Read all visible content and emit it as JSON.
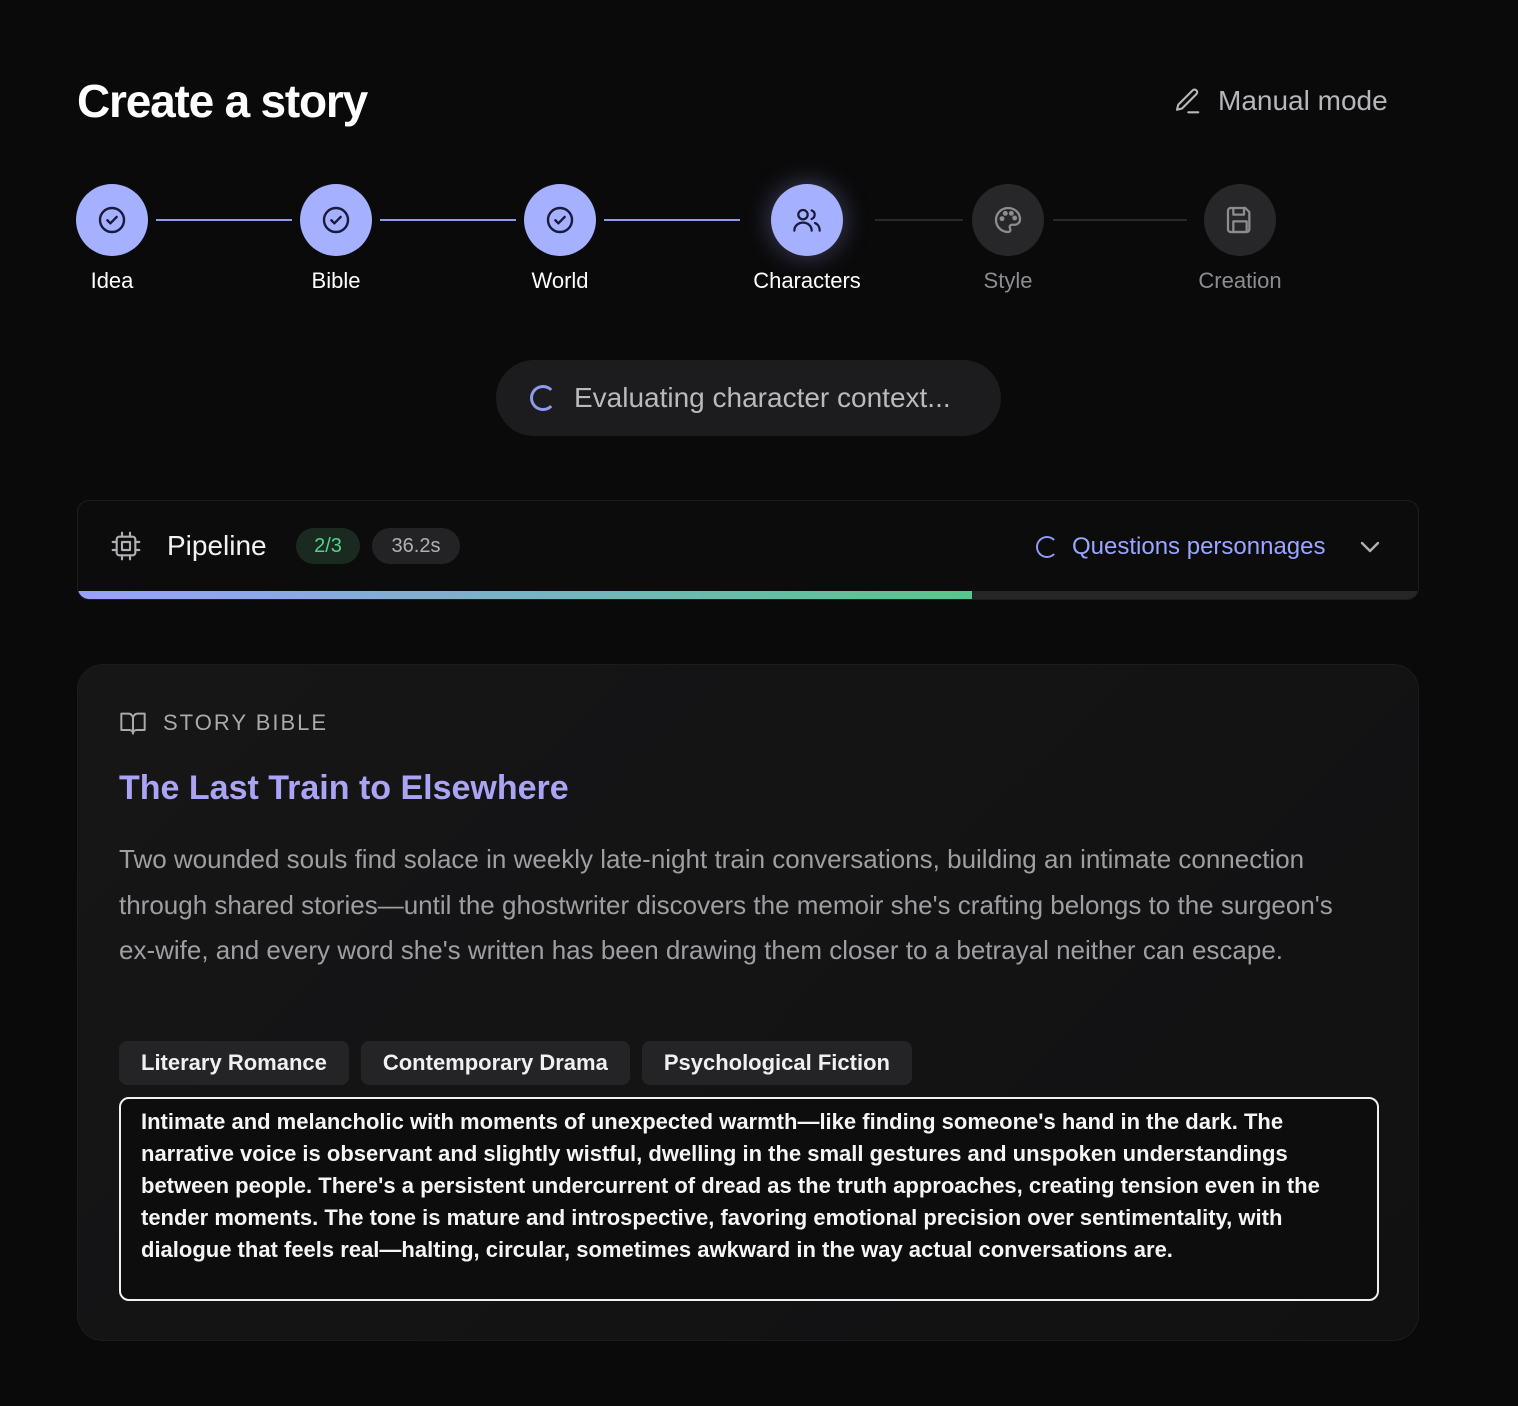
{
  "header": {
    "title": "Create a story",
    "manual_mode_label": "Manual mode",
    "manual_mode_icon": "pencil-icon"
  },
  "stepper": {
    "steps": [
      {
        "label": "Idea",
        "state": "done",
        "icon": "check-circle-icon"
      },
      {
        "label": "Bible",
        "state": "done",
        "icon": "check-circle-icon"
      },
      {
        "label": "World",
        "state": "done",
        "icon": "check-circle-icon"
      },
      {
        "label": "Characters",
        "state": "active",
        "icon": "users-icon"
      },
      {
        "label": "Style",
        "state": "todo",
        "icon": "palette-icon"
      },
      {
        "label": "Creation",
        "state": "todo",
        "icon": "save-icon"
      }
    ]
  },
  "status": {
    "text": "Evaluating character context..."
  },
  "pipeline": {
    "title": "Pipeline",
    "count": "2/3",
    "elapsed": "36.2s",
    "current_step": "Questions personnages",
    "progress_fraction": 0.667,
    "colors": {
      "progress_start": "#9aa0ff",
      "progress_end": "#56c78a",
      "count_badge_text": "#4fd38c"
    }
  },
  "story_bible": {
    "section_label": "STORY BIBLE",
    "title": "The Last Train to Elsewhere",
    "logline": "Two wounded souls find solace in weekly late-night train conversations, building an intimate connection through shared stories—until the ghostwriter discovers the memoir she's crafting belongs to the surgeon's ex-wife, and every word she's written has been drawing them closer to a betrayal neither can escape.",
    "genres": [
      "Literary Romance",
      "Contemporary Drama",
      "Psychological Fiction"
    ],
    "tone": "Intimate and melancholic with moments of unexpected warmth—like finding someone's hand in the dark. The narrative voice is observant and slightly wistful, dwelling in the small gestures and unspoken understandings between people. There's a persistent undercurrent of dread as the truth approaches, creating tension even in the tender moments. The tone is mature and introspective, favoring emotional precision over sentimentality, with dialogue that feels real—halting, circular, sometimes awkward in the way actual conversations are."
  },
  "colors": {
    "accent": "#a5b0ff",
    "title_accent": "#a9a4f4",
    "background": "#0a0a0b"
  }
}
